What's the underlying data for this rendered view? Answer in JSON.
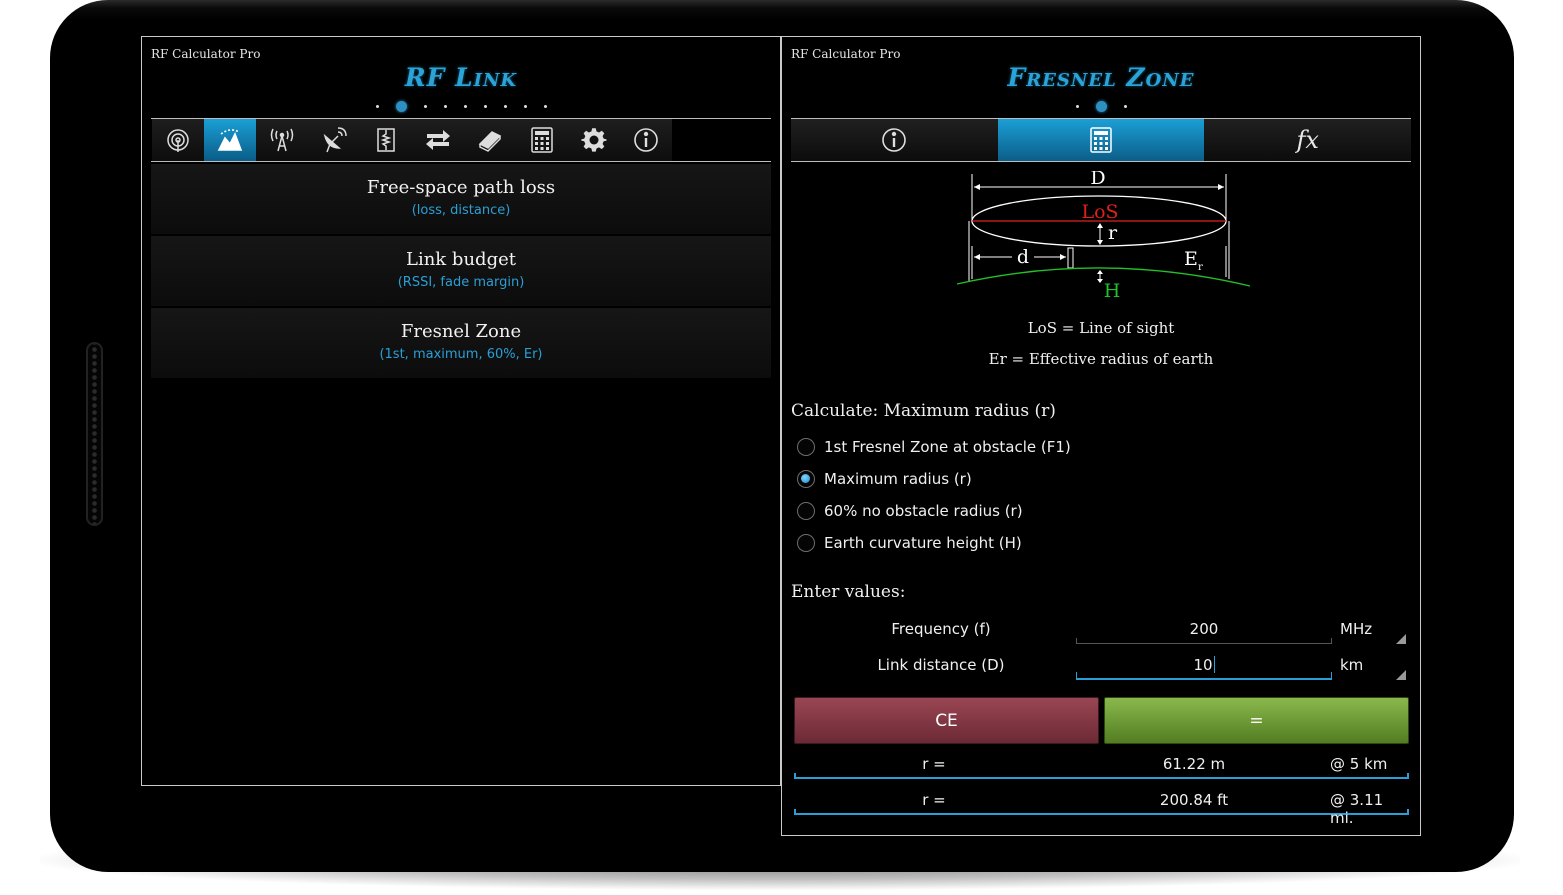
{
  "left_pane": {
    "app_label": "RF Calculator Pro",
    "title": "RF Link",
    "toolbar": [
      {
        "name": "antenna-icon",
        "active": false
      },
      {
        "name": "rf-link-icon",
        "active": true
      },
      {
        "name": "tower-icon",
        "active": false
      },
      {
        "name": "satellite-dish-icon",
        "active": false
      },
      {
        "name": "resistor-icon",
        "active": false
      },
      {
        "name": "convert-icon",
        "active": false
      },
      {
        "name": "book-icon",
        "active": false
      },
      {
        "name": "calculator-icon",
        "active": false
      },
      {
        "name": "gear-icon",
        "active": false
      },
      {
        "name": "info-icon",
        "active": false
      }
    ],
    "items": [
      {
        "title": "Free-space path loss",
        "subtitle": "(loss, distance)"
      },
      {
        "title": "Link budget",
        "subtitle": "(RSSI, fade margin)"
      },
      {
        "title": "Fresnel Zone",
        "subtitle": "(1st, maximum, 60%, Er)"
      }
    ]
  },
  "right_pane": {
    "app_label": "RF Calculator Pro",
    "title": "Fresnel Zone",
    "tabs": [
      {
        "name": "info-icon",
        "active": false
      },
      {
        "name": "calculator-icon",
        "active": true
      },
      {
        "name": "fx-icon",
        "label": "fx",
        "active": false
      }
    ],
    "diagram": {
      "D": "D",
      "LoS": "LoS",
      "r": "r",
      "d": "d",
      "Er": "E",
      "Er_sub": "r",
      "H": "H"
    },
    "legend": {
      "los": "LoS = Line of sight",
      "er": "Er = Effective radius of earth"
    },
    "calculate_label": "Calculate: Maximum radius (r)",
    "options": [
      {
        "label": "1st Fresnel Zone at obstacle (F1)",
        "checked": false
      },
      {
        "label": "Maximum radius (r)",
        "checked": true
      },
      {
        "label": "60% no obstacle radius (r)",
        "checked": false
      },
      {
        "label": "Earth curvature height (H)",
        "checked": false
      }
    ],
    "enter_values_label": "Enter values:",
    "fields": [
      {
        "label": "Frequency (f)",
        "value": "200",
        "unit": "MHz",
        "focused": false
      },
      {
        "label": "Link distance (D)",
        "value": "10",
        "unit": "km",
        "focused": true
      }
    ],
    "buttons": {
      "clear": "CE",
      "equals": "="
    },
    "results": [
      {
        "label": "r =",
        "value": "61.22 m",
        "at": "@ 5 km"
      },
      {
        "label": "r =",
        "value": "200.84 ft",
        "at": "@ 3.11 mi."
      }
    ]
  },
  "colors": {
    "accent": "#2a9fd6",
    "ce_button": "#7f3641",
    "equals_button": "#6f9a35",
    "los_red": "#e0201c",
    "earth_green": "#22c02a"
  }
}
